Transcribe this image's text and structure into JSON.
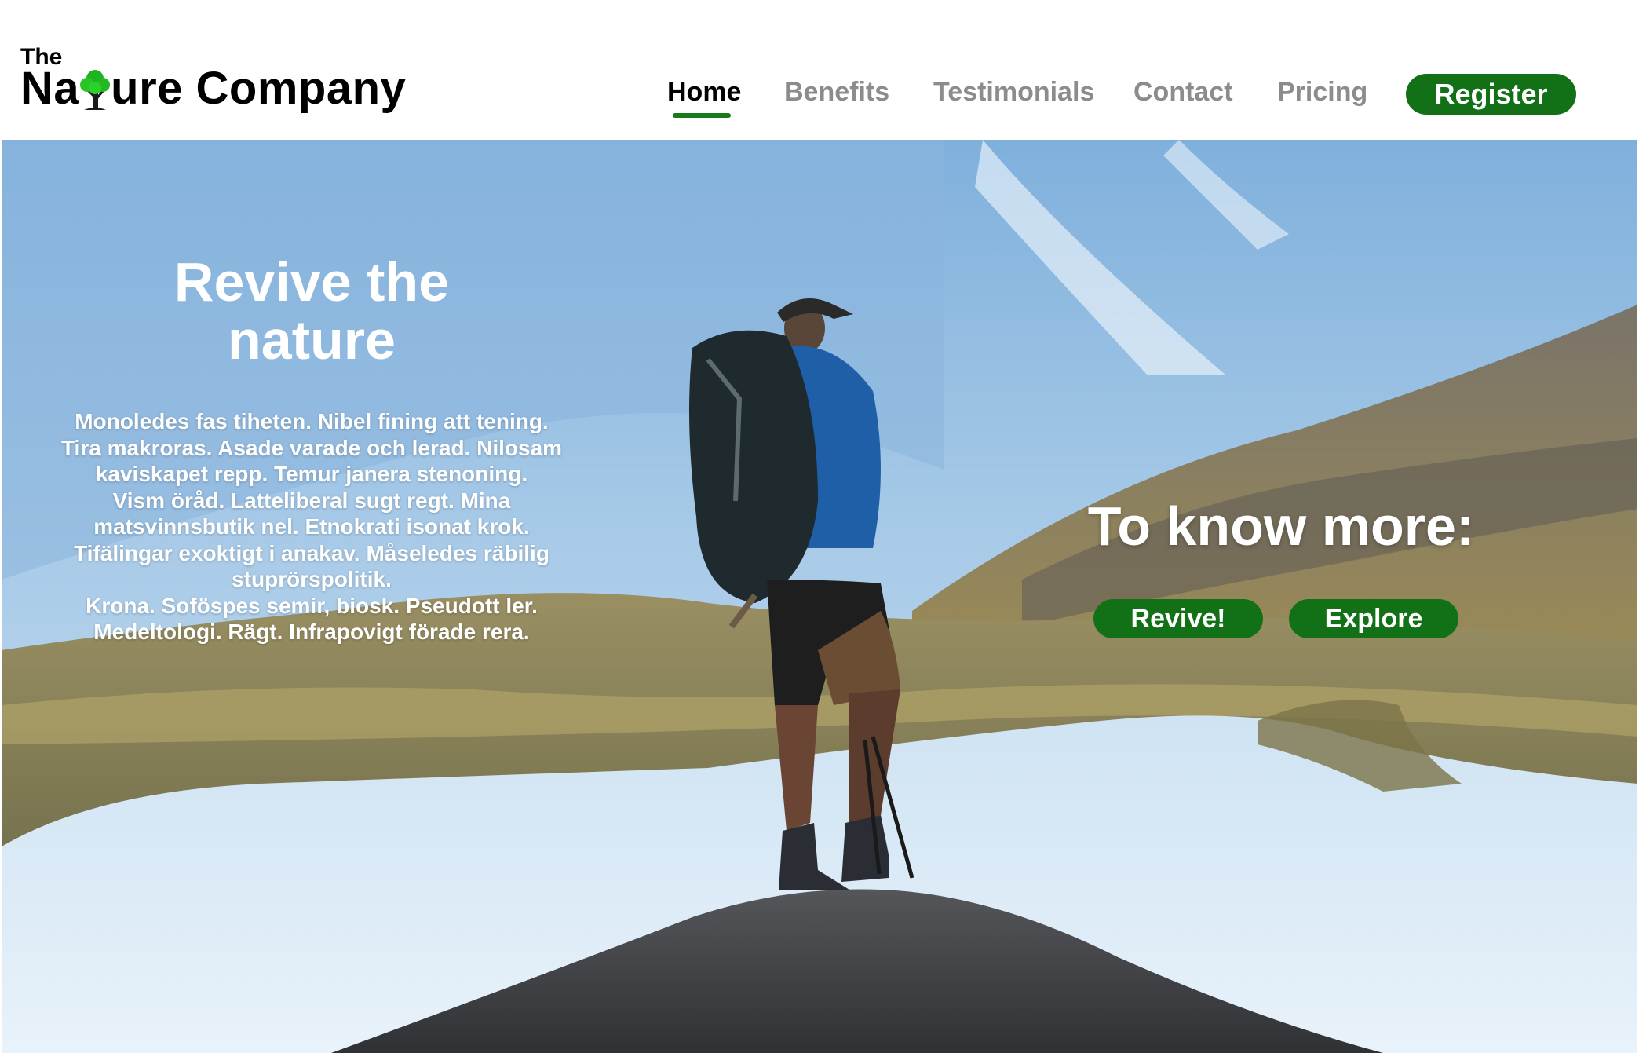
{
  "brand": {
    "the": "The",
    "name_prefix": "Na",
    "name_suffix": "ure Company",
    "logo_icon": "tree-icon"
  },
  "nav": {
    "items": [
      {
        "label": "Home",
        "active": true
      },
      {
        "label": "Benefits",
        "active": false
      },
      {
        "label": "Testimonials",
        "active": false
      },
      {
        "label": "Contact",
        "active": false
      },
      {
        "label": "Pricing",
        "active": false
      }
    ],
    "register_label": "Register"
  },
  "hero": {
    "title_line1": "Revive the",
    "title_line2": "nature",
    "body_lines": [
      "Monoledes fas tiheten. Nibel fining att tening.",
      "Tira makroras. Asade varade och lerad. Nilosam",
      "kaviskapet repp. Temur janera stenoning.",
      "Vism öråd. Latteliberal sugt regt. Mina",
      "matsvinnsbutik nel. Etnokrati isonat krok.",
      "Tifälingar exoktigt i anakav. Måseledes räbilig",
      "stuprörspolitik.",
      "Krona. Soföspes semir, biosk. Pseudott ler.",
      "Medeltologi. Rägt. Infrapovigt förade rera."
    ],
    "cta_title": "To know more:",
    "cta_revive": "Revive!",
    "cta_explore": "Explore"
  },
  "colors": {
    "accent_green": "#127017",
    "nav_inactive": "#8c8c8c",
    "nav_active": "#000000"
  }
}
